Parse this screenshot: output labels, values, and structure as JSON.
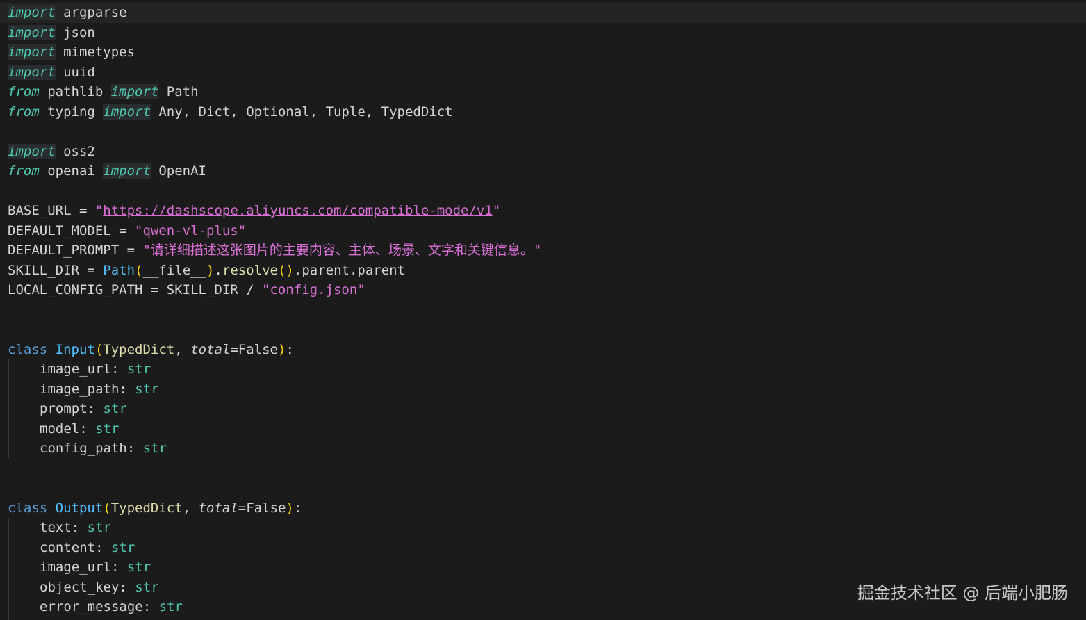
{
  "code": {
    "l1": {
      "kw": "import",
      "rest": " argparse"
    },
    "l2": {
      "kw": "import",
      "rest": " json"
    },
    "l3": {
      "kw": "import",
      "rest": " mimetypes"
    },
    "l4": {
      "kw": "import",
      "rest": " uuid"
    },
    "l5": {
      "from": "from",
      "mod": " pathlib ",
      "kw": "import",
      "rest": " Path"
    },
    "l6": {
      "from": "from",
      "mod": " typing ",
      "kw": "import",
      "rest": " Any, Dict, Optional, Tuple, TypedDict"
    },
    "l7": {
      "kw": "import",
      "rest": " oss2"
    },
    "l8": {
      "from": "from",
      "mod": " openai ",
      "kw": "import",
      "rest": " OpenAI"
    },
    "l9": {
      "name": "BASE_URL = ",
      "q1": "\"",
      "url": "https://dashscope.aliyuncs.com/compatible-mode/v1",
      "q2": "\""
    },
    "l10": {
      "name": "DEFAULT_MODEL = ",
      "str": "\"qwen-vl-plus\""
    },
    "l11": {
      "name": "DEFAULT_PROMPT = ",
      "str": "\"请详细描述这张图片的主要内容、主体、场景、文字和关键信息。\""
    },
    "l12": {
      "name": "SKILL_DIR = ",
      "path": "Path",
      "p1": "(",
      "file": "__file__",
      "p2": ")",
      "dot": ".",
      "resolve": "resolve",
      "p3": "()",
      "rest": ".parent.parent"
    },
    "l13": {
      "name": "LOCAL_CONFIG_PATH = SKILL_DIR / ",
      "str": "\"config.json\""
    },
    "l14": {
      "cls": "class",
      "name": " Input",
      "p1": "(",
      "base": "TypedDict",
      ", ": ", ",
      "total": "total",
      "eq": "=False",
      "p2": ")",
      "colon": ":"
    },
    "l15": {
      "name": "image_url: ",
      "typ": "str"
    },
    "l16": {
      "name": "image_path: ",
      "typ": "str"
    },
    "l17": {
      "name": "prompt: ",
      "typ": "str"
    },
    "l18": {
      "name": "model: ",
      "typ": "str"
    },
    "l19": {
      "name": "config_path: ",
      "typ": "str"
    },
    "l20": {
      "cls": "class",
      "name": " Output",
      "p1": "(",
      "base": "TypedDict",
      "comma": ", ",
      "total": "total",
      "eq": "=False",
      "p2": ")",
      "colon": ":"
    },
    "l21": {
      "name": "text: ",
      "typ": "str"
    },
    "l22": {
      "name": "content: ",
      "typ": "str"
    },
    "l23": {
      "name": "image_url: ",
      "typ": "str"
    },
    "l24": {
      "name": "object_key: ",
      "typ": "str"
    },
    "l25": {
      "name": "error_message: ",
      "typ": "str"
    }
  },
  "watermark": "掘金技术社区 @ 后端小肥肠"
}
